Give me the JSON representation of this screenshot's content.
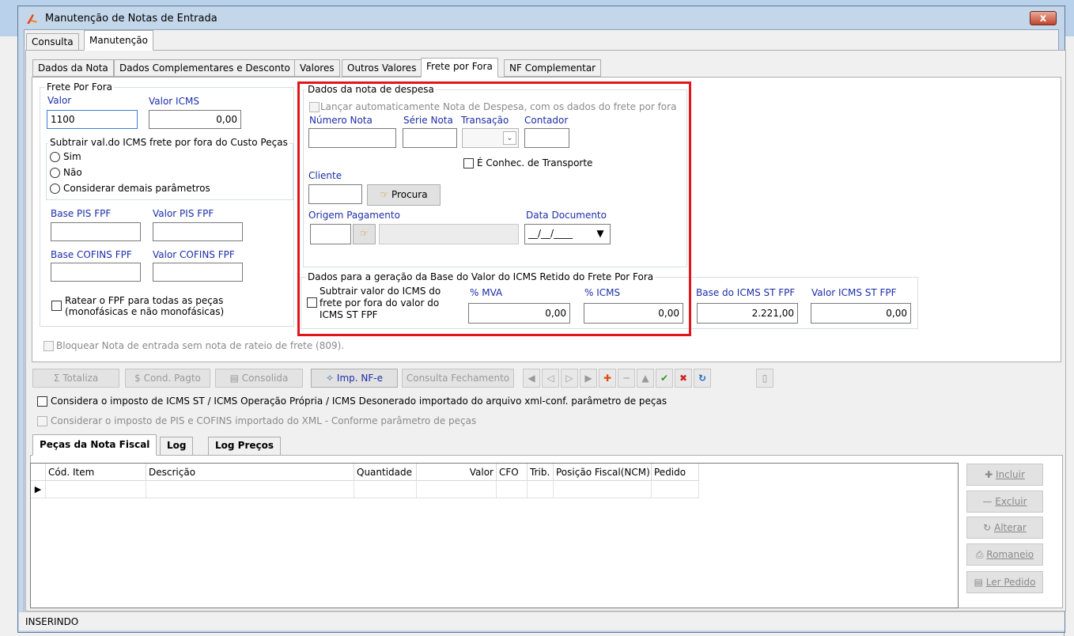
{
  "window": {
    "title": "Manutenção de Notas de Entrada",
    "close_label": "x"
  },
  "main_tabs": [
    "Consulta",
    "Manutenção"
  ],
  "sub_tabs": [
    "Dados da Nota",
    "Dados Complementares e Desconto",
    "Valores",
    "Outros Valores",
    "Frete por Fora",
    "NF Complementar"
  ],
  "frete_por_fora": {
    "group_label": "Frete Por Fora",
    "valor_label": "Valor",
    "valor_value": "1100",
    "valor_icms_label": "Valor ICMS",
    "valor_icms_value": "0,00",
    "subtrair_label": "Subtrair val.do ICMS frete por fora do Custo Peças",
    "options": [
      "Sim",
      "Não",
      "Considerar demais parâmetros"
    ],
    "base_pis_label": "Base PIS FPF",
    "valor_pis_label": "Valor PIS FPF",
    "base_cofins_label": "Base COFINS FPF",
    "valor_cofins_label": "Valor COFINS FPF",
    "ratear_label_1": "Ratear o FPF para todas as peças",
    "ratear_label_2": "(monofásicas e não monofásicas)"
  },
  "despesa": {
    "group_label": "Dados da nota de despesa",
    "lancar_label": "Lançar automaticamente Nota de Despesa, com os dados do frete por fora",
    "numero_nota_label": "Número Nota",
    "serie_nota_label": "Série Nota",
    "transacao_label": "Transação",
    "contador_label": "Contador",
    "conhec_label": "É Conhec. de Transporte",
    "cliente_label": "Cliente",
    "procura_label": "Procura",
    "origem_label": "Origem Pagamento",
    "data_doc_label": "Data Documento",
    "data_doc_value": "__/__/____"
  },
  "icms_retido": {
    "group_label": "Dados para a geração da Base do Valor do ICMS Retido do Frete Por Fora",
    "subtrair_1": "Subtrair valor do ICMS do",
    "subtrair_2": "frete por fora do valor do",
    "subtrair_3": "ICMS ST FPF",
    "mva_label": "% MVA",
    "mva_value": "0,00",
    "icms_label": "% ICMS",
    "icms_value": "0,00",
    "base_st_label": "Base do ICMS ST FPF",
    "base_st_value": "2.221,00",
    "valor_st_label": "Valor ICMS ST FPF",
    "valor_st_value": "0,00"
  },
  "bloquear_label": "Bloquear Nota de entrada sem nota de rateio de frete (809).",
  "toolbar": {
    "totaliza": "Totaliza",
    "cond_pagto": "Cond. Pagto",
    "consolida": "Consolida",
    "imp_nfe": "Imp. NF-e",
    "consulta_fechamento": "Consulta Fechamento"
  },
  "considera_label": "Considera o imposto de ICMS ST / ICMS Operação Própria / ICMS Desonerado importado do arquivo xml-conf. parâmetro de peças",
  "considerar_pis_label": "Considerar o imposto de PIS e COFINS importado do XML - Conforme parâmetro de peças",
  "bottom_tabs": [
    "Peças da Nota Fiscal",
    "Log",
    "Log Preços"
  ],
  "grid": {
    "columns": [
      "Cód. Item",
      "Descrição",
      "Quantidade",
      "Valor",
      "CFO",
      "Trib.",
      "Posição Fiscal(NCM)",
      "Pedido"
    ]
  },
  "side_buttons": {
    "incluir": "Incluir",
    "excluir": "Excluir",
    "alterar": "Alterar",
    "romaneio": "Romaneio",
    "ler_pedido": "Ler Pedido"
  },
  "status": "INSERINDO",
  "colors": {
    "accent_red": "#e2151b",
    "label_blue": "#1c2ea8"
  }
}
